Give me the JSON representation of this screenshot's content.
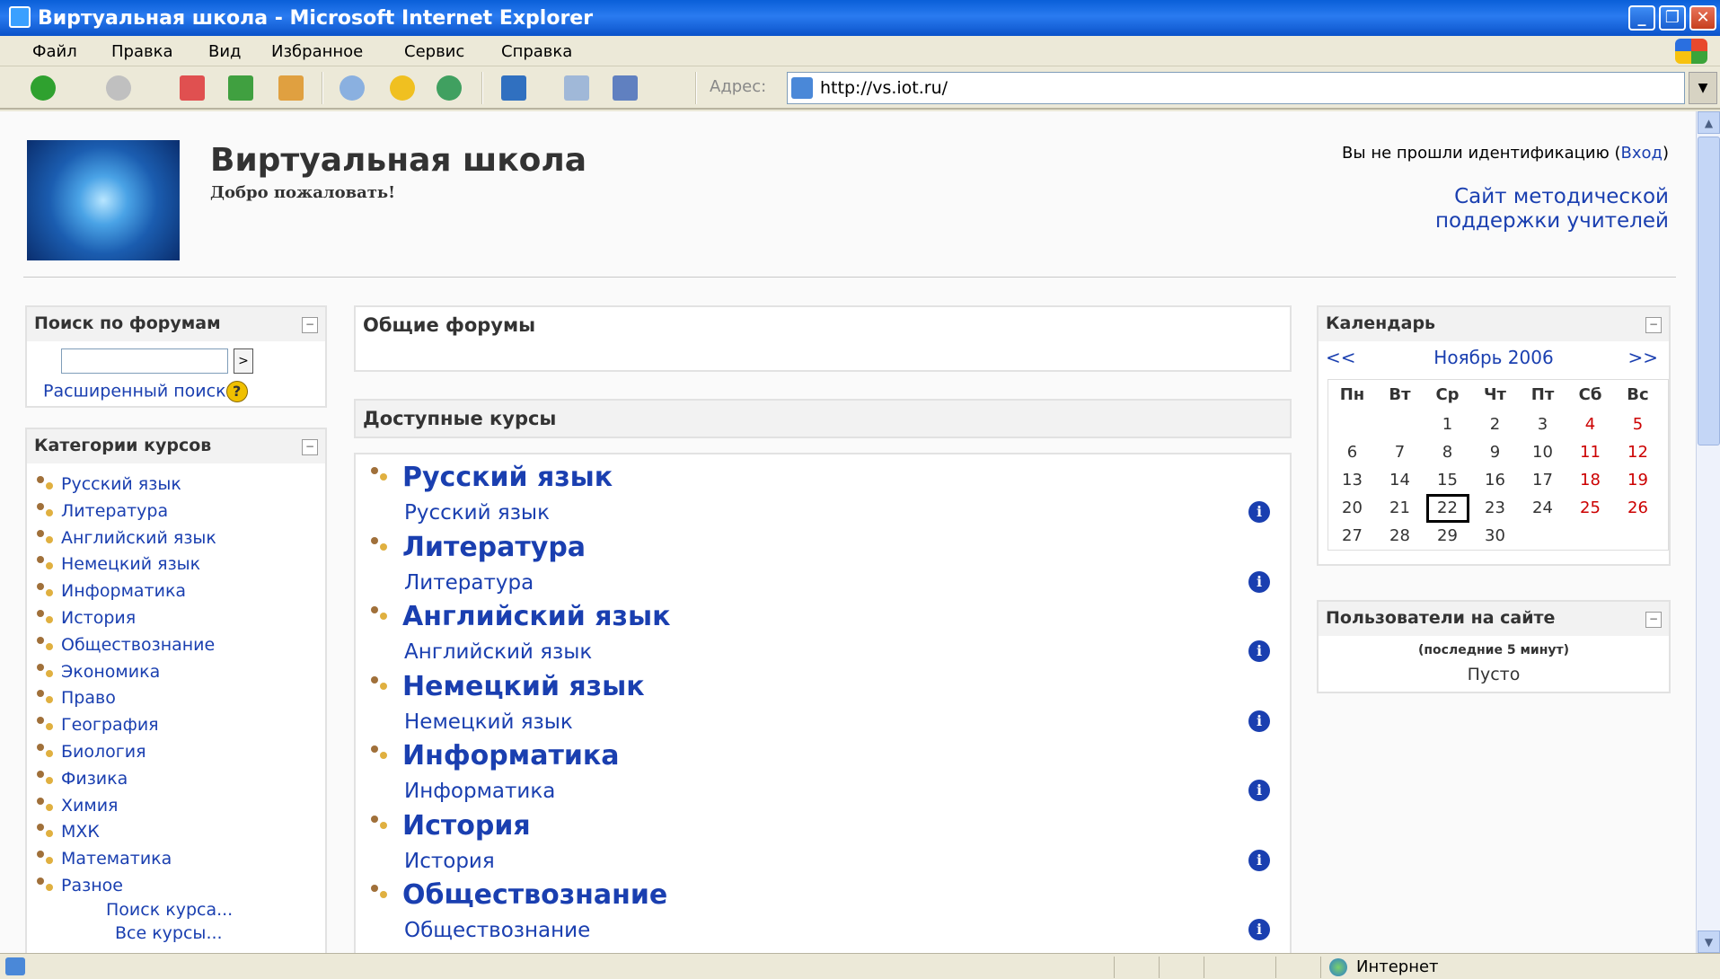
{
  "window": {
    "title": "Виртуальная школа - Microsoft Internet Explorer"
  },
  "menu": [
    "Файл",
    "Правка",
    "Вид",
    "Избранное",
    "Сервис",
    "Справка"
  ],
  "address": {
    "label": "Адрес:",
    "url": "http://vs.iot.ru/"
  },
  "header": {
    "site_title": "Виртуальная школа",
    "welcome": "Добро пожаловать!",
    "login_text": "Вы не прошли идентификацию (",
    "login_link": "Вход",
    "login_close": ")",
    "support_link": "Сайт методической поддержки учителей"
  },
  "forum_search": {
    "title": "Поиск по форумам",
    "go": ">",
    "advanced": "Расширенный поиск"
  },
  "categories": {
    "title": "Категории курсов",
    "items": [
      "Русский язык",
      "Литература",
      "Английский язык",
      "Немецкий язык",
      "Информатика",
      "История",
      "Обществознание",
      "Экономика",
      "Право",
      "География",
      "Биология",
      "Физика",
      "Химия",
      "МХК",
      "Математика",
      "Разное"
    ],
    "search_course": "Поиск курса...",
    "all_courses": "Все курсы..."
  },
  "general_forums": {
    "title": "Общие форумы"
  },
  "courses": {
    "title": "Доступные курсы",
    "items": [
      {
        "name": "Русский язык",
        "summary": "Русский язык"
      },
      {
        "name": "Литература",
        "summary": "Литература"
      },
      {
        "name": "Английский язык",
        "summary": "Английский язык"
      },
      {
        "name": "Немецкий язык",
        "summary": "Немецкий язык"
      },
      {
        "name": "Информатика",
        "summary": "Информатика"
      },
      {
        "name": "История",
        "summary": "История"
      },
      {
        "name": "Обществознание",
        "summary": "Обществознание"
      }
    ]
  },
  "calendar": {
    "title": "Календарь",
    "prev": "<<",
    "next": ">>",
    "month": "Ноябрь 2006",
    "weekdays": [
      "Пн",
      "Вт",
      "Ср",
      "Чт",
      "Пт",
      "Сб",
      "Вс"
    ],
    "weeks": [
      [
        "",
        "",
        "1",
        "2",
        "3",
        "4",
        "5"
      ],
      [
        "6",
        "7",
        "8",
        "9",
        "10",
        "11",
        "12"
      ],
      [
        "13",
        "14",
        "15",
        "16",
        "17",
        "18",
        "19"
      ],
      [
        "20",
        "21",
        "22",
        "23",
        "24",
        "25",
        "26"
      ],
      [
        "27",
        "28",
        "29",
        "30",
        "",
        "",
        ""
      ]
    ],
    "today": "22",
    "weekend_color": "#cc0000"
  },
  "online_users": {
    "title": "Пользователи на сайте",
    "subtitle": "(последние 5 минут)",
    "empty": "Пусто"
  },
  "status": {
    "zone": "Интернет"
  }
}
